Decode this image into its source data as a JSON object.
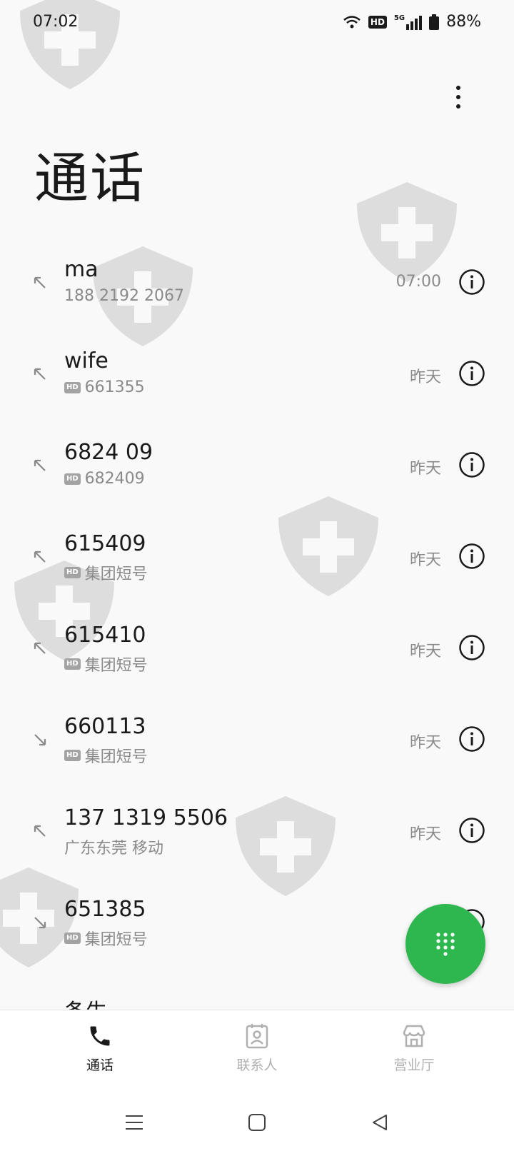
{
  "status_bar": {
    "time": "07:02",
    "hd_badge": "HD",
    "network": "5G",
    "battery": "88%"
  },
  "page": {
    "title": "通话"
  },
  "calls": [
    {
      "name": "ma",
      "sub": "188 2192 2067",
      "hd": false,
      "time": "07:00",
      "direction": "outgoing"
    },
    {
      "name": "wife",
      "sub": "661355",
      "hd": true,
      "time": "昨天",
      "direction": "outgoing"
    },
    {
      "name": "6824 09",
      "sub": "682409",
      "hd": true,
      "time": "昨天",
      "direction": "outgoing"
    },
    {
      "name": "615409",
      "sub": "集团短号",
      "hd": true,
      "time": "昨天",
      "direction": "outgoing"
    },
    {
      "name": "615410",
      "sub": "集团短号",
      "hd": true,
      "time": "昨天",
      "direction": "outgoing"
    },
    {
      "name": "660113",
      "sub": "集团短号",
      "hd": true,
      "time": "昨天",
      "direction": "incoming"
    },
    {
      "name": "137 1319 5506",
      "sub": "广东东莞 移动",
      "hd": false,
      "time": "昨天",
      "direction": "outgoing"
    },
    {
      "name": "651385",
      "sub": "集团短号",
      "hd": true,
      "time": "",
      "direction": "incoming"
    }
  ],
  "partial_row_name": "条生",
  "hd_small_label": "HD",
  "bottom_nav": [
    {
      "label": "通话",
      "icon": "phone-icon",
      "active": true
    },
    {
      "label": "联系人",
      "icon": "contacts-icon",
      "active": false
    },
    {
      "label": "营业厅",
      "icon": "store-icon",
      "active": false
    }
  ],
  "colors": {
    "accent_green": "#2db74e",
    "text_primary": "#1a1a1a",
    "text_secondary": "#8a8a8a",
    "nav_inactive": "#b0b0b0"
  }
}
